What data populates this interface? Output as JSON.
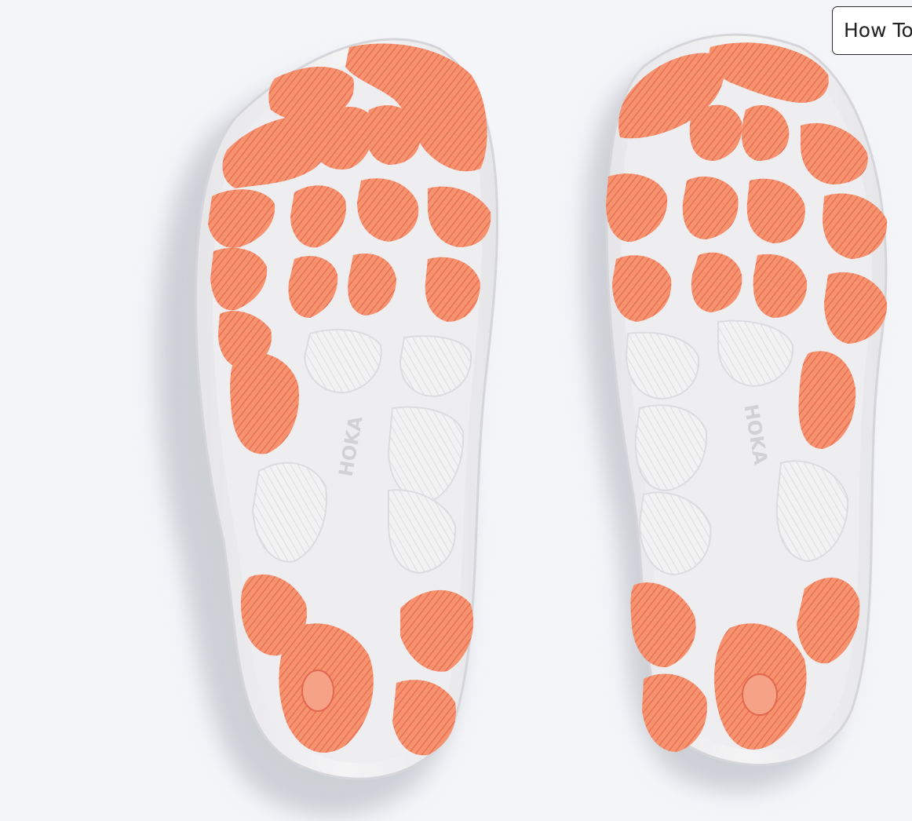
{
  "howto_button": {
    "label": "How To"
  },
  "image": {
    "subject": "hoka-outsole-pair",
    "brand_mark_left": "HOKA",
    "brand_mark_right": "HOKA"
  },
  "colors": {
    "background": "#f4f5f9",
    "sole_white": "#f1f1f2",
    "sole_edge": "#dcdcdf",
    "rubber": "#f7926f",
    "rubber_dark": "#e8735a",
    "shadow": "#b9bcc2"
  }
}
